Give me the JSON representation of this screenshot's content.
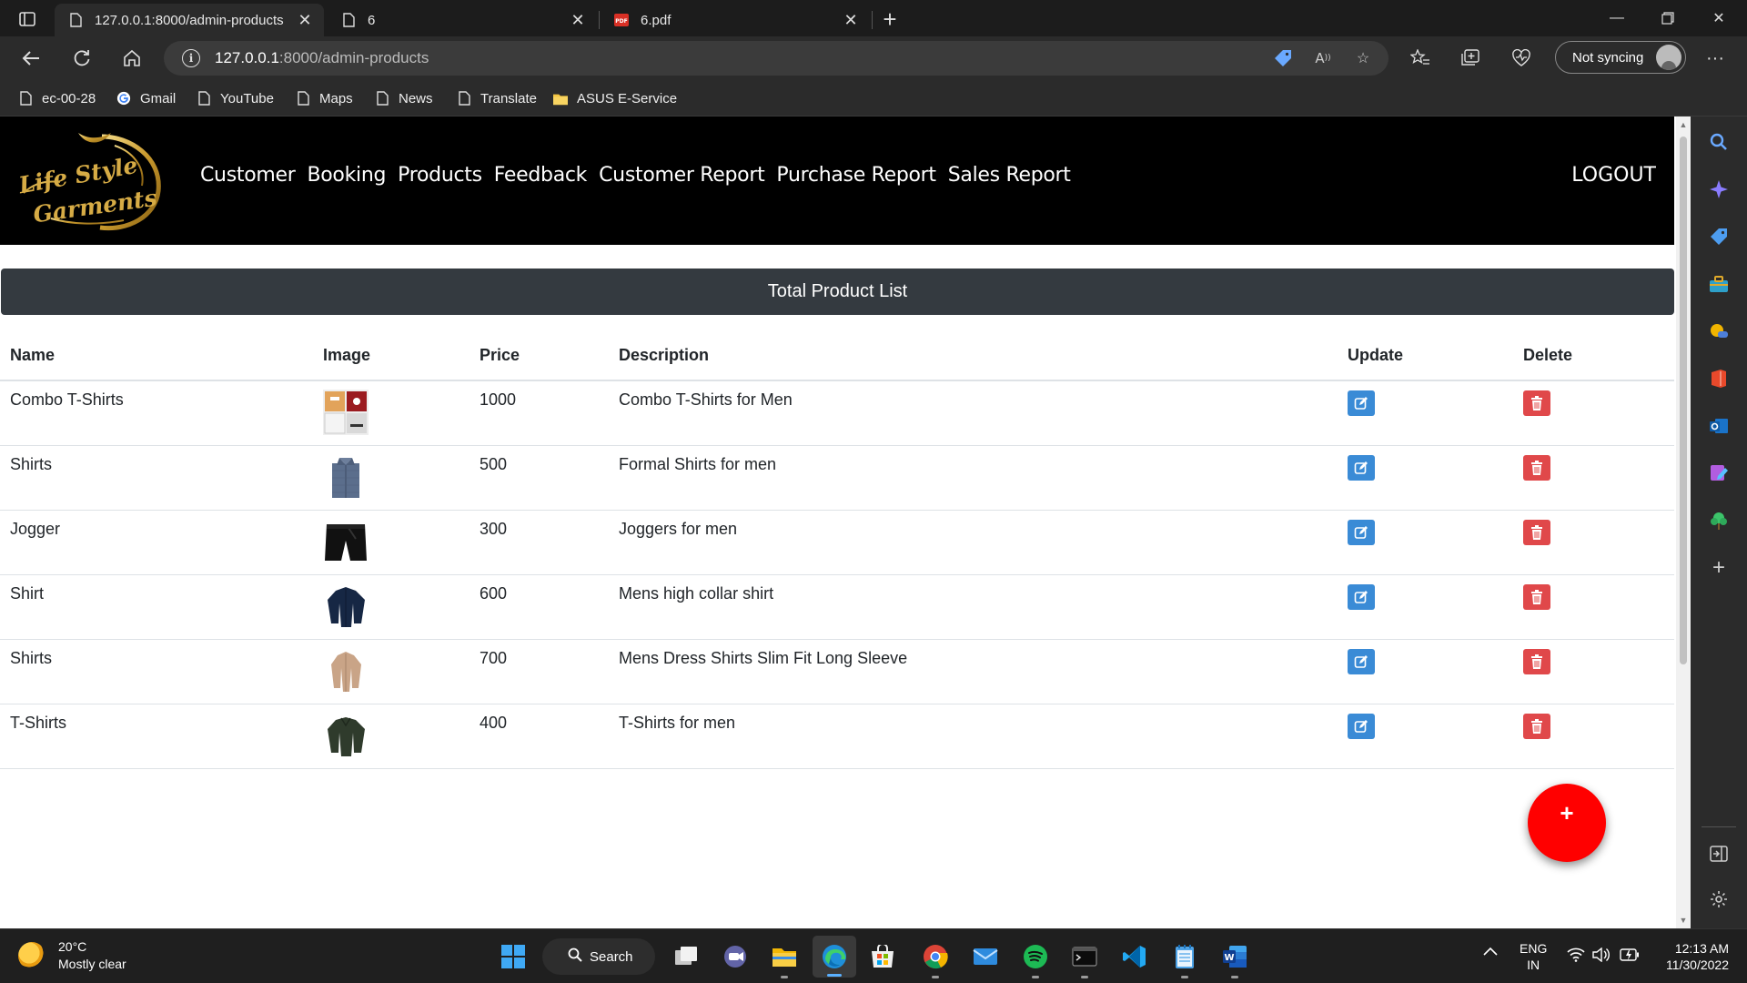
{
  "browser": {
    "tabs": [
      {
        "title": "127.0.0.1:8000/admin-products",
        "active": true
      },
      {
        "title": "6",
        "active": false
      },
      {
        "title": "6.pdf",
        "active": false
      }
    ],
    "address": {
      "host": "127.0.0.1",
      "rest": ":8000/admin-products"
    },
    "sync_label": "Not syncing",
    "bookmarks": [
      "ec-00-28",
      "Gmail",
      "YouTube",
      "Maps",
      "News",
      "Translate",
      "ASUS E-Service"
    ]
  },
  "site": {
    "logo_text": [
      "Life Style",
      "Garments"
    ],
    "nav": [
      "Customer",
      "Booking",
      "Products",
      "Feedback",
      "Customer Report",
      "Purchase Report",
      "Sales Report"
    ],
    "logout": "LOGOUT"
  },
  "product_list": {
    "title": "Total Product List",
    "columns": [
      "Name",
      "Image",
      "Price",
      "Description",
      "Update",
      "Delete"
    ],
    "rows": [
      {
        "name": "Combo T-Shirts",
        "price": "1000",
        "description": "Combo T-Shirts for Men",
        "image": "combo-tshirts-image"
      },
      {
        "name": "Shirts",
        "price": "500",
        "description": "Formal Shirts for men",
        "image": "formal-shirt-image"
      },
      {
        "name": "Jogger",
        "price": "300",
        "description": "Joggers for men",
        "image": "jogger-image"
      },
      {
        "name": "Shirt",
        "price": "600",
        "description": "Mens high collar shirt",
        "image": "navy-shirt-image"
      },
      {
        "name": "Shirts",
        "price": "700",
        "description": "Mens Dress Shirts Slim Fit Long Sleeve",
        "image": "beige-shirt-image"
      },
      {
        "name": "T-Shirts",
        "price": "400",
        "description": "T-Shirts for men",
        "image": "olive-tshirt-image"
      }
    ],
    "add_button": "+"
  },
  "taskbar": {
    "weather": {
      "temp": "20°C",
      "condition": "Mostly clear"
    },
    "search_label": "Search",
    "lang": [
      "ENG",
      "IN"
    ],
    "time": "12:13 AM",
    "date": "11/30/2022"
  },
  "colors": {
    "header_bg": "#000000",
    "banner_bg": "#343a40",
    "update_btn": "#3a8bd6",
    "delete_btn": "#e0484a",
    "fab": "#ff0000"
  }
}
